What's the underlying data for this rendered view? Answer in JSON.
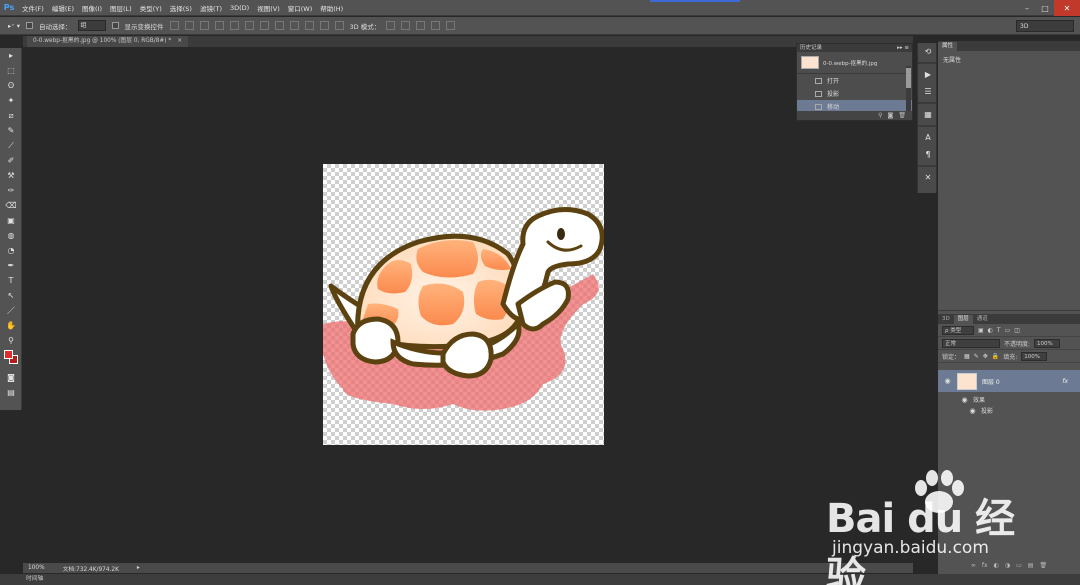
{
  "app": {
    "logo": "Ps",
    "workspace": "3D"
  },
  "menu": [
    "文件(F)",
    "编辑(E)",
    "图像(I)",
    "图层(L)",
    "类型(Y)",
    "选择(S)",
    "滤镜(T)",
    "3D(D)",
    "视图(V)",
    "窗口(W)",
    "帮助(H)"
  ],
  "options": {
    "auto_select_label": "自动选择：",
    "auto_select_value": "组",
    "show_transform_label": "显示变换控件",
    "mode_3d_label": "3D 模式："
  },
  "document": {
    "tab_title": "0-0.webp-抠黑的.jpg @ 100% (图层 0, RGB/8#) *",
    "close": "×"
  },
  "history": {
    "title": "历史记录",
    "controls": "▸▸ ≡",
    "snapshot_name": "0-0.webp-抠黑的.jpg",
    "items": [
      {
        "label": "打开",
        "active": false
      },
      {
        "label": "投影",
        "active": false
      },
      {
        "label": "移动",
        "active": true
      }
    ],
    "footer_icons": [
      "⚲",
      "◙",
      "🗑"
    ]
  },
  "properties": {
    "tabs": [
      "属性"
    ],
    "empty_text": "无属性"
  },
  "layers": {
    "tabs": [
      "3D",
      "图层",
      "通道"
    ],
    "kind_label": "ρ 类型",
    "blend_mode": "正常",
    "opacity_label": "不透明度:",
    "opacity_value": "100%",
    "lock_label": "锁定：",
    "fill_label": "填充:",
    "fill_value": "100%",
    "layer_name": "图层 0",
    "fx": "fx",
    "effects_label": "效果",
    "effect_item": "投影",
    "footer_icons": [
      "∞",
      "fx",
      "◐",
      "◑",
      "▭",
      "▤",
      "🗑"
    ]
  },
  "status": {
    "zoom": "100%",
    "doc_info": "文档:732.4K/974.2K",
    "arrow": "▸"
  },
  "bottom": {
    "label": "时间轴"
  },
  "watermark": {
    "logo": "Bai du 经验",
    "url": "jingyan.baidu.com"
  },
  "tools": [
    "▸",
    "⬚",
    "ʘ",
    "✦",
    "⧄",
    "✎",
    "⟋",
    "✐",
    "⚒",
    "✑",
    "⌫",
    "▣",
    "◍",
    "◔",
    "✒",
    "T",
    "↖",
    "／",
    "✋",
    "⚲"
  ]
}
